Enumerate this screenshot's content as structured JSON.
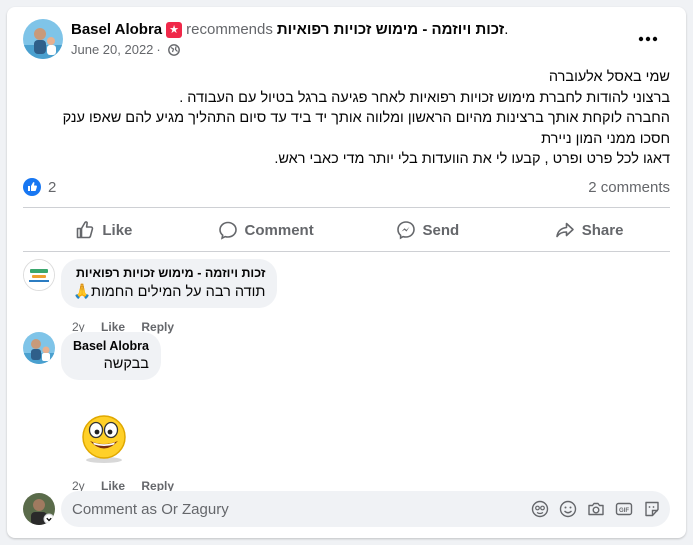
{
  "post": {
    "author": "Basel Alobra",
    "action": "recommends",
    "page_name": "זכות ויוזמה - מימוש זכויות רפואיות",
    "page_suffix": ".",
    "date": "June 20, 2022",
    "separator": "·",
    "more_icon": "more-options-icon",
    "body_lines": [
      "שמי באסל אלעוברה",
      "ברצוני להודות לחברת מימוש זכויות רפואיות לאחר פגיעה ברגל בטיול עם העבודה .",
      "החברה לוקחת אותך ברצינות מהיום הראשון ומלווה אותך יד ביד עד סיום התהליך מגיע להם שאפו ענק",
      "חסכו ממני המון ניירת",
      "דאגו לכל פרט ופרט , קבעו לי את הוועדות בלי יותר מדי כאבי ראש."
    ],
    "reactions_count": "2",
    "comments_count": "2 comments"
  },
  "actions": {
    "like": "Like",
    "comment": "Comment",
    "send": "Send",
    "share": "Share"
  },
  "comments": [
    {
      "author": "זכות ויוזמה - מימוש זכויות רפואיות",
      "text": "תודה רבה על המילים החמות🙏",
      "age": "2y",
      "like": "Like",
      "reply": "Reply"
    },
    {
      "author": "Basel Alobra",
      "text": "בבקשה",
      "sticker": "smiling-emoji-sticker",
      "age": "2y",
      "like": "Like",
      "reply": "Reply"
    }
  ],
  "composer": {
    "placeholder": "Comment as Or Zagury",
    "tools": [
      "avatar-sticker-icon",
      "emoji-icon",
      "camera-icon",
      "gif-icon",
      "sticker-icon"
    ]
  },
  "colors": {
    "accent": "#1877f2",
    "secondary_text": "#65676b",
    "badge": "#f02849",
    "bubble": "#f0f2f5"
  }
}
